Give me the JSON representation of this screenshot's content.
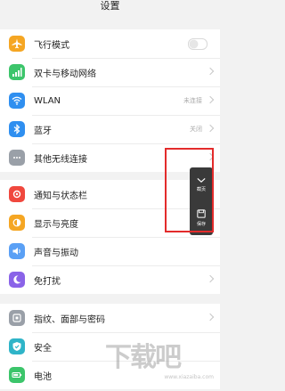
{
  "header": {
    "title": "设置"
  },
  "groups": [
    {
      "items": [
        {
          "label": "飞行模式",
          "icon": "airplane-icon",
          "color": "#f5a623",
          "control": "toggle",
          "toggle_on": false
        },
        {
          "label": "双卡与移动网络",
          "icon": "signal-icon",
          "color": "#3cc56b"
        },
        {
          "label": "WLAN",
          "icon": "wifi-icon",
          "color": "#2f8ff0",
          "value": "未连接"
        },
        {
          "label": "蓝牙",
          "icon": "bluetooth-icon",
          "color": "#2f8ff0",
          "value": "关闭"
        },
        {
          "label": "其他无线连接",
          "icon": "more-dots-icon",
          "color": "#9aa0a8"
        }
      ]
    },
    {
      "items": [
        {
          "label": "通知与状态栏",
          "icon": "notification-icon",
          "color": "#f0483e"
        },
        {
          "label": "显示与亮度",
          "icon": "brightness-icon",
          "color": "#f5a623"
        },
        {
          "label": "声音与振动",
          "icon": "sound-icon",
          "color": "#5aa0f5"
        },
        {
          "label": "免打扰",
          "icon": "moon-icon",
          "color": "#8a63e8"
        }
      ]
    },
    {
      "items": [
        {
          "label": "指纹、面部与密码",
          "icon": "fingerprint-icon",
          "color": "#9aa0a8"
        },
        {
          "label": "安全",
          "icon": "shield-icon",
          "color": "#2fb4c8"
        },
        {
          "label": "电池",
          "icon": "battery-icon",
          "color": "#3cc56b"
        }
      ]
    }
  ],
  "side_panel": {
    "collapse_label": "截页",
    "save_label": "保存"
  },
  "watermark": {
    "text": "下载吧",
    "url": "www.xiazaiba.com"
  },
  "colors": {
    "highlight": "#e32b2b"
  }
}
